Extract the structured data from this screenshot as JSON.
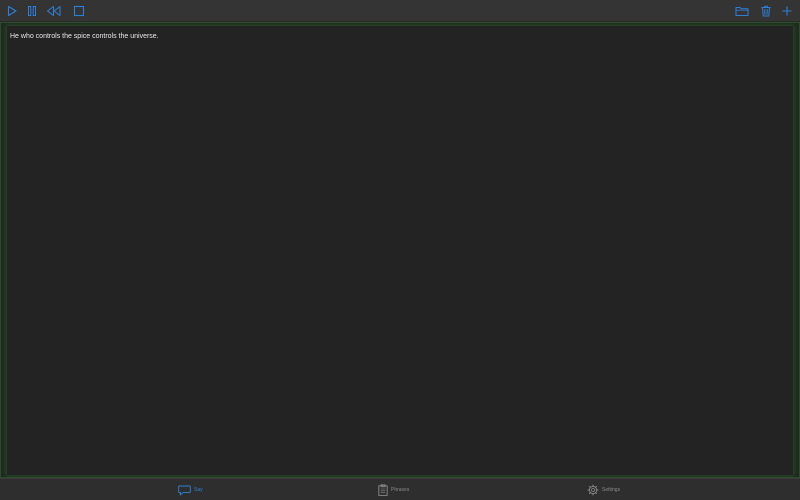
{
  "colors": {
    "accent": "#2f7fd8",
    "icon_inactive": "#8a8a8a",
    "text": "#e8e8e8"
  },
  "toolbar": {
    "left_icons": [
      "play-icon",
      "pause-icon",
      "rewind-icon",
      "stop-icon"
    ],
    "right_icons": [
      "folder-icon",
      "trash-icon",
      "plus-icon"
    ]
  },
  "editor": {
    "text": "He who controls the spice controls the universe."
  },
  "tabs": [
    {
      "label": "Say",
      "icon": "speech-bubble-icon",
      "selected": true
    },
    {
      "label": "Phrases",
      "icon": "clipboard-icon",
      "selected": false
    },
    {
      "label": "Settings",
      "icon": "gear-icon",
      "selected": false
    }
  ]
}
